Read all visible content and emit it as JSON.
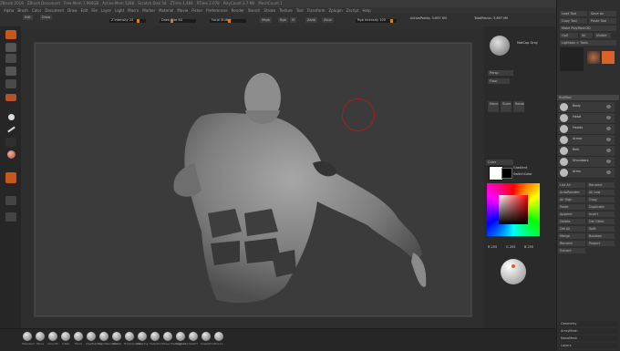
{
  "titlebar": [
    "ZBrush 2018",
    "ZBrush Document",
    "Free Mem 7.994GB",
    "Active Mem 1288",
    "Scratch Disk 54",
    "ZTime 1.484",
    "RTime 2.078",
    "PolyCount 3.7 Mil",
    "MeshCount 1"
  ],
  "titlebar_right": [
    "QuickSave",
    "See-through 0",
    "Menus",
    "DefaultZScript"
  ],
  "menubar": [
    "Alpha",
    "Brush",
    "Color",
    "Document",
    "Draw",
    "Edit",
    "File",
    "Layer",
    "Light",
    "Macro",
    "Marker",
    "Material",
    "Movie",
    "Picker",
    "Preferences",
    "Render",
    "Stencil",
    "Stroke",
    "Texture",
    "Tool",
    "Transform",
    "Zplugin",
    "Zscript",
    "Help"
  ],
  "toprow": {
    "left_buttons": [
      "Edit",
      "Draw",
      "Move",
      "Scale",
      "Rotate"
    ],
    "sliders": [
      "Z Intensity 25",
      "Draw Size 64",
      "Focal Shift 0",
      "Mrgb",
      "Rgb",
      "M",
      "Zadd",
      "Zsub",
      "Dynamic",
      "Rgb Intensity 100"
    ],
    "right_tags": [
      "ActivePoints: 3.697 Mil",
      "TotalPoints: 3.697 Mil"
    ]
  },
  "leftbar": [
    "Projection Master",
    "LightBox",
    "Quick Sketch",
    "Edit",
    "Draw",
    "Move",
    "Scale",
    "Rotate",
    "Standard",
    "Dots",
    "Alpha Off",
    "Texture Off",
    "MatCap Gray",
    "BPR",
    "SPix 3"
  ],
  "rightpanel": {
    "matcap_label": "MatCap Gray",
    "buttons": [
      "Persp",
      "Floor",
      "Local",
      "Move",
      "Scale",
      "Rotate"
    ],
    "swatch_labels": [
      "Gradient",
      "SwitchColor",
      "Alternate"
    ],
    "color_label": "Color",
    "rgb": [
      "R 255",
      "G 255",
      "B 255"
    ]
  },
  "farright": {
    "top_buttons": [
      "Load Tool",
      "Save As",
      "Copy Tool",
      "Paste Tool",
      "Import",
      "Export",
      "Clone",
      "Make PolyMesh3D",
      "GoZ",
      "All",
      "Visible",
      "R"
    ],
    "section": "Lightbox > Tools",
    "subtool_header": "SubTool",
    "subtools": [
      "Body",
      "Head",
      "Hands",
      "Armor",
      "Belt",
      "Shoulders",
      "Arms"
    ],
    "actions": [
      "List All",
      "Rename",
      "AutoReorder",
      "All Low",
      "All High",
      "Copy",
      "Paste",
      "Duplicate",
      "Append",
      "Insert",
      "Delete",
      "Del Other",
      "Del All",
      "Split",
      "Merge",
      "Boolean",
      "Remesh",
      "Project",
      "Extract"
    ],
    "bottom": [
      "Geometry",
      "ArrayMesh",
      "NanoMesh",
      "Layers"
    ]
  },
  "bottombar": [
    "Standard",
    "Move",
    "Smooth",
    "Inflat",
    "Pinch",
    "ClayBuildup",
    "DamStandard",
    "hPolish",
    "TrimDynamic",
    "Masking",
    "Selection",
    "Move Topological",
    "ClipCurve",
    "Slash3",
    "SnakeHook",
    "Curve"
  ],
  "colors": {
    "accent": "#d9622a",
    "bg": "#2b2b2b",
    "canvas": "#3b3b3b",
    "brush_ring": "#a52020"
  }
}
